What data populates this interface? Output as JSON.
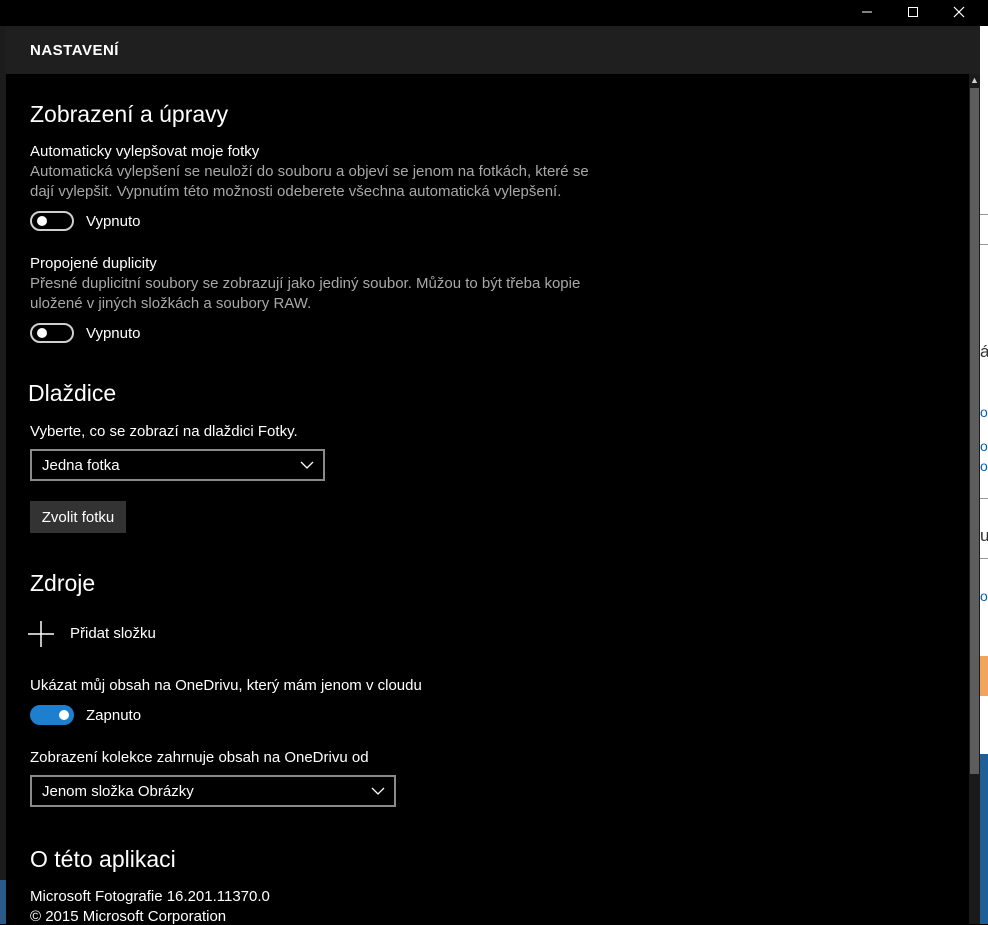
{
  "window": {
    "minimize_glyph": "—",
    "maximize_glyph": "☐",
    "close_glyph": "✕"
  },
  "header": {
    "title": "NASTAVENÍ"
  },
  "sections": {
    "display": {
      "heading": "Zobrazení a úpravy",
      "auto_enhance": {
        "label": "Automaticky vylepšovat moje fotky",
        "desc": "Automatická vylepšení se neuloží do souboru a objeví se jenom na fotkách, které se dají vylepšit. Vypnutím této možnosti odeberete všechna automatická vylepšení.",
        "state": "Vypnuto",
        "on": false
      },
      "duplicates": {
        "label": "Propojené duplicity",
        "desc": "Přesné duplicitní soubory se zobrazují jako jediný soubor. Můžou to být třeba kopie uložené v jiných složkách a soubory RAW.",
        "state": "Vypnuto",
        "on": false
      }
    },
    "tile": {
      "heading": "Dlaždice",
      "label": "Vyberte, co se zobrazí na dlaždici Fotky.",
      "selected": "Jedna fotka",
      "button": "Zvolit fotku"
    },
    "sources": {
      "heading": "Zdroje",
      "add_folder": "Přidat složku",
      "onedrive_toggle": {
        "label": "Ukázat můj obsah na OneDrivu, který mám jenom v cloudu",
        "state": "Zapnuto",
        "on": true
      },
      "collection_label": "Zobrazení kolekce zahrnuje obsah na OneDrivu od",
      "collection_selected": "Jenom složka Obrázky"
    },
    "about": {
      "heading": "O této aplikaci",
      "version": "Microsoft Fotografie 16.201.11370.0",
      "copyright": "© 2015 Microsoft Corporation"
    }
  },
  "background_fragments": [
    "á",
    "o",
    "o",
    "o",
    "u",
    "o"
  ],
  "colors": {
    "accent": "#1e7fcf",
    "background": "#000000",
    "header": "#1f1f1f",
    "secondary_text": "#a8a8a8"
  }
}
